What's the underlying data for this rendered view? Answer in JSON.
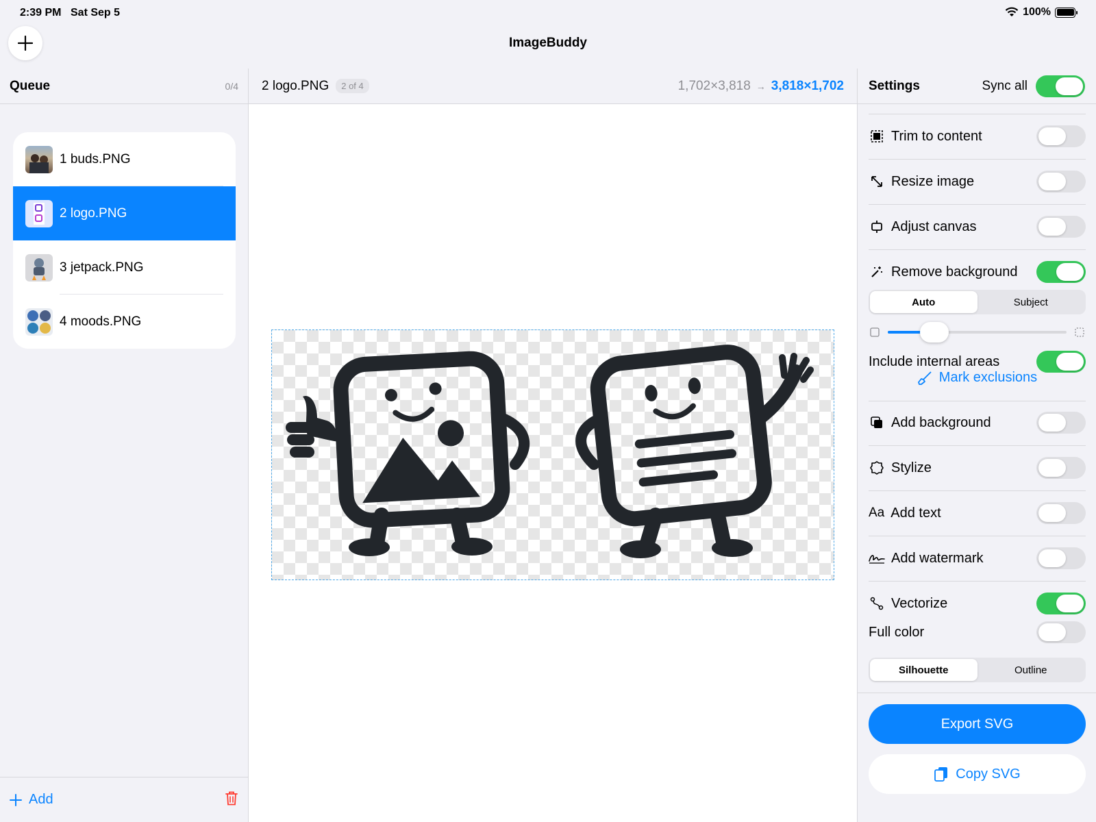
{
  "status": {
    "time": "2:39 PM",
    "date": "Sat Sep 5",
    "battery": "100%"
  },
  "app": {
    "title": "ImageBuddy"
  },
  "queue": {
    "title": "Queue",
    "count": "0/4",
    "items": [
      {
        "label": "1 buds.PNG"
      },
      {
        "label": "2 logo.PNG"
      },
      {
        "label": "3 jetpack.PNG"
      },
      {
        "label": "4 moods.PNG"
      }
    ],
    "add_label": "Add"
  },
  "preview": {
    "filename": "2 logo.PNG",
    "position": "2 of 4",
    "orig_dims": "1,702×3,818",
    "arrow": "→",
    "new_dims": "3,818×1,702"
  },
  "settings": {
    "title": "Settings",
    "sync_label": "Sync all",
    "sync_on": true,
    "trim": "Trim to content",
    "resize": "Resize image",
    "canvas": "Adjust canvas",
    "remove_bg": "Remove background",
    "bg_mode": [
      "Auto",
      "Subject"
    ],
    "internal": "Include internal areas",
    "mark": "Mark exclusions",
    "add_bg": "Add background",
    "stylize": "Stylize",
    "add_text_icon": "Aa",
    "add_text": "Add text",
    "watermark": "Add watermark",
    "vectorize": "Vectorize",
    "full_color": "Full color",
    "vector_mode": [
      "Silhouette",
      "Outline"
    ],
    "slider_value": 0.26,
    "export": "Export SVG",
    "copy": "Copy SVG"
  },
  "colors": {
    "accent": "#0a84ff",
    "toggle_on": "#34c759",
    "destructive": "#ff3b30"
  }
}
